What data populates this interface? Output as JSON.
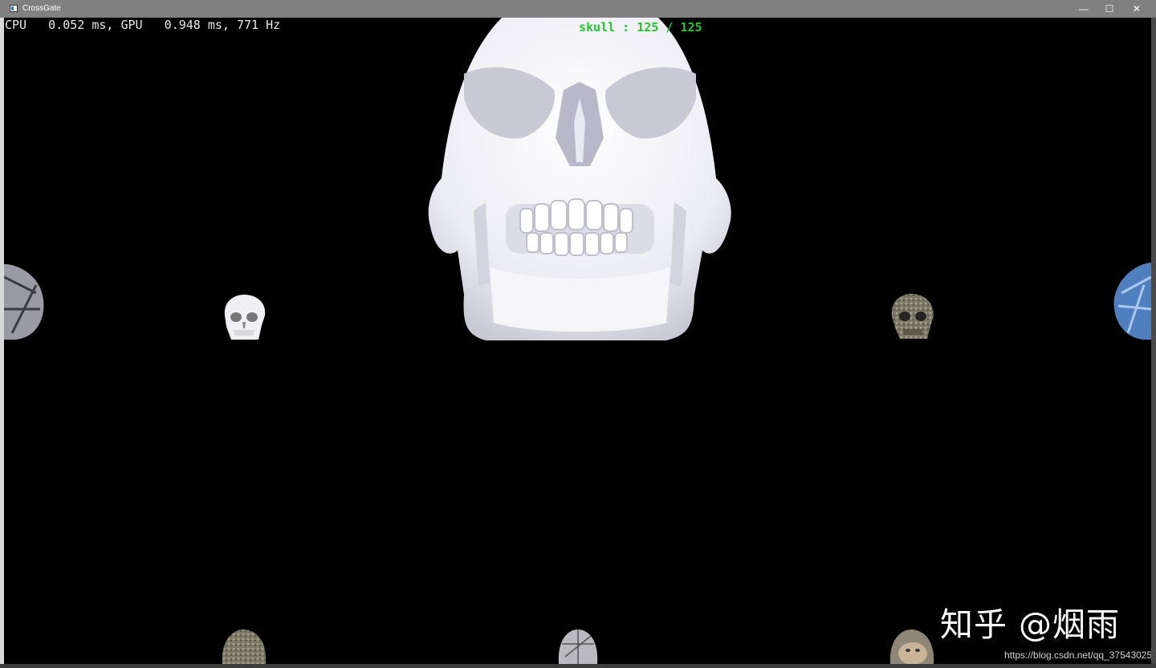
{
  "window": {
    "title": "CrossGate",
    "minimize_glyph": "—",
    "maximize_glyph": "☐",
    "close_glyph": "✕"
  },
  "overlay": {
    "stats": "CPU   0.052 ms, GPU   0.948 ms, 771 Hz",
    "counter": "skull : 125 / 125"
  },
  "watermark": {
    "text": "知乎 @烟雨",
    "url": "https://blog.csdn.net/qq_37543025"
  },
  "icons": [
    "app-icon",
    "minimize-icon",
    "maximize-icon",
    "close-icon"
  ],
  "colors": {
    "counter": "#22c52e",
    "background": "#000000",
    "titlebar": "#808080",
    "skull_white": "#f2f2f8",
    "skull_stone": "#8a8670",
    "skull_blue": "#4f7fbf"
  }
}
